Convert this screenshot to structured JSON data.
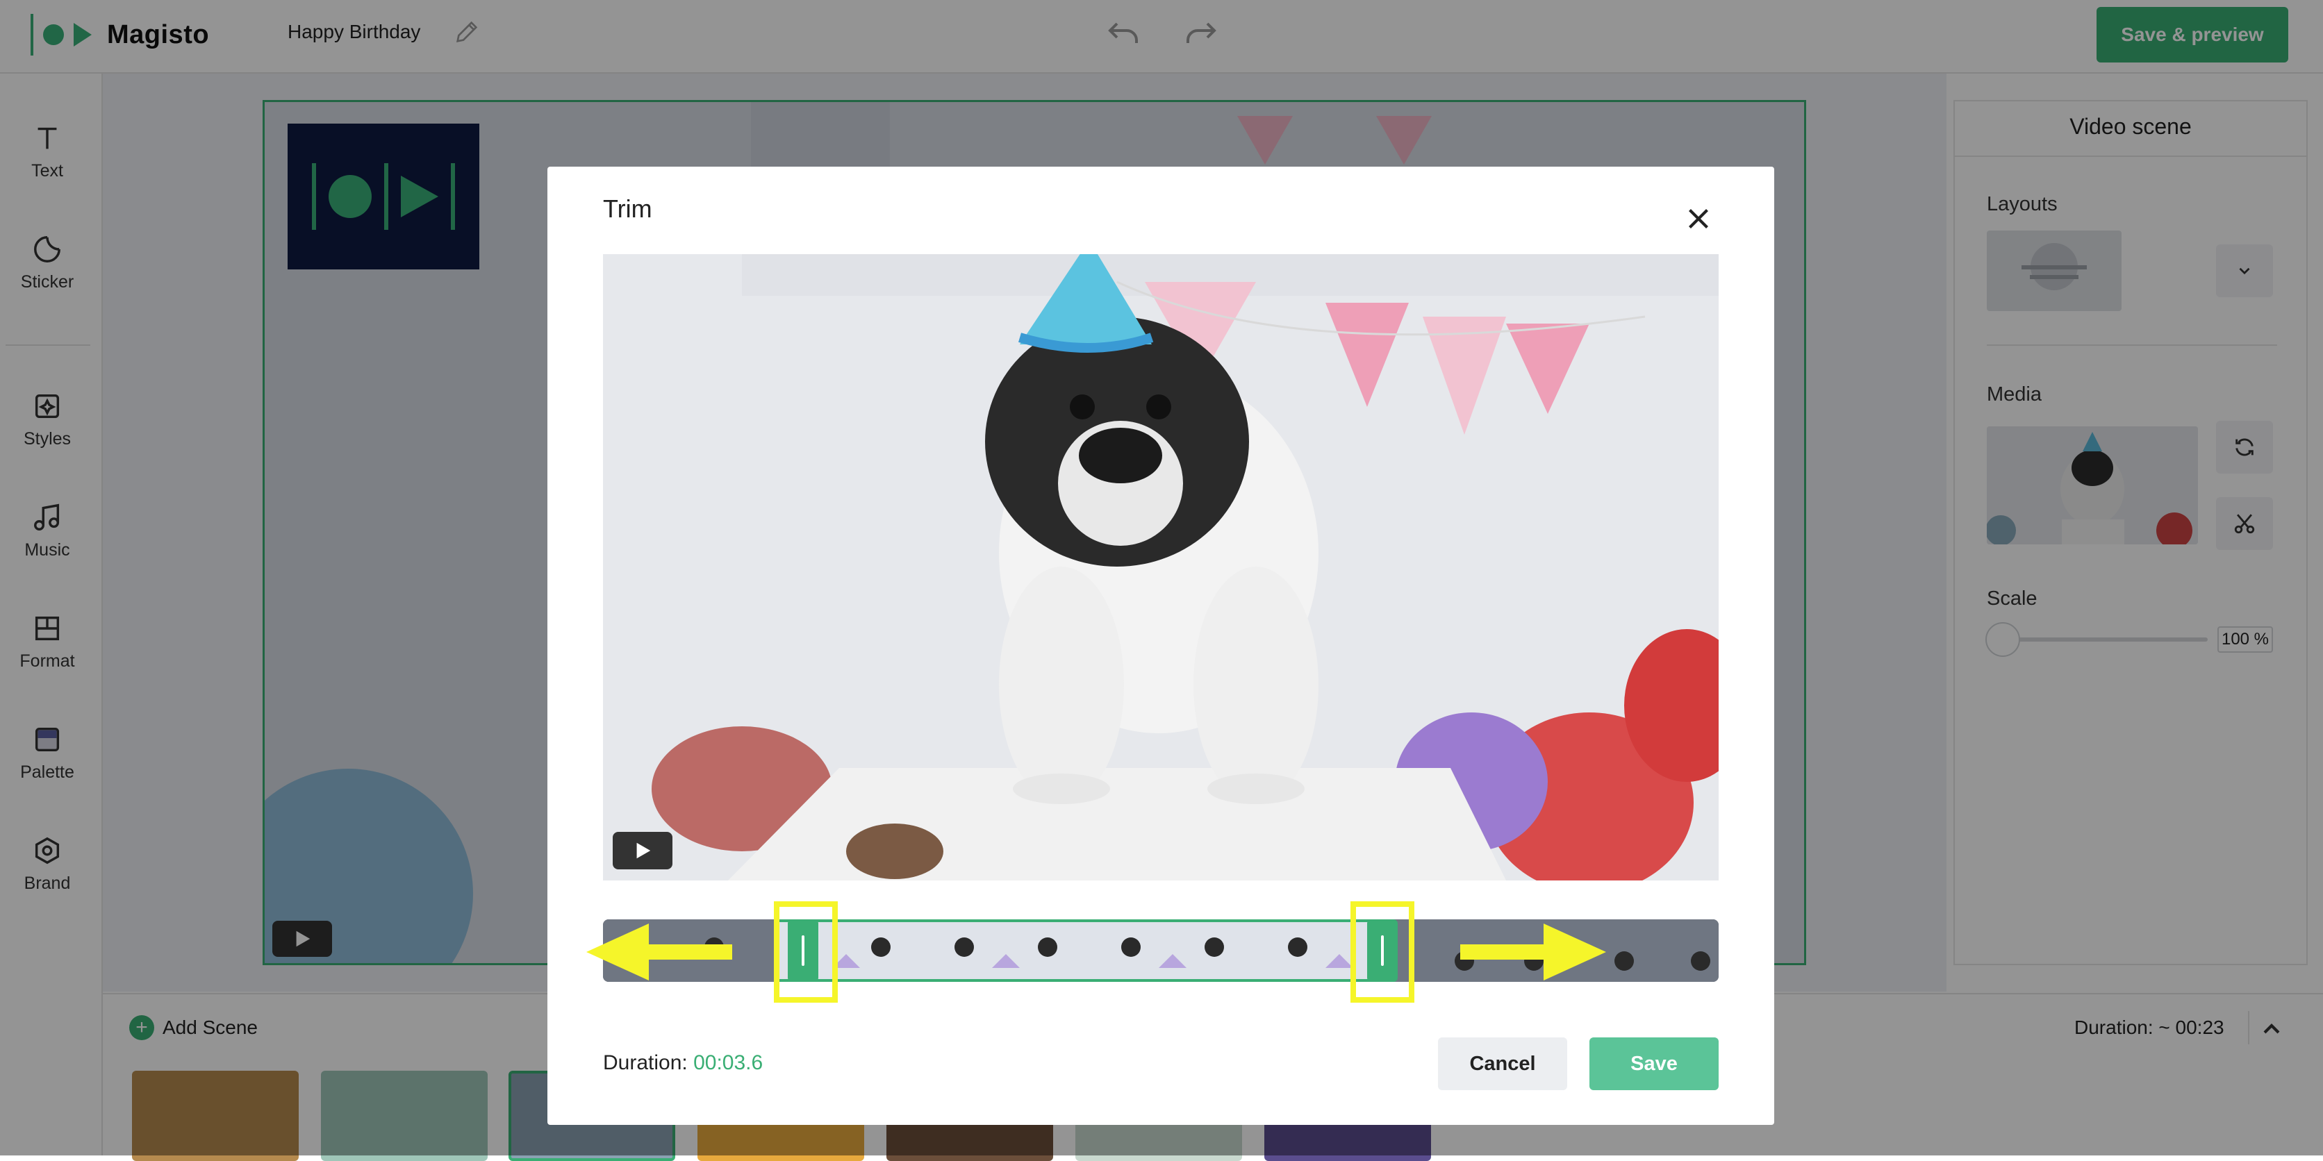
{
  "app": {
    "name": "Magisto",
    "project_title": "Happy Birthday",
    "save_preview_label": "Save & preview"
  },
  "sidebar": {
    "items": [
      {
        "label": "Text",
        "icon": "text-icon"
      },
      {
        "label": "Sticker",
        "icon": "sticker-icon"
      },
      {
        "label": "Styles",
        "icon": "styles-icon"
      },
      {
        "label": "Music",
        "icon": "music-icon"
      },
      {
        "label": "Format",
        "icon": "format-icon"
      },
      {
        "label": "Palette",
        "icon": "palette-icon"
      },
      {
        "label": "Brand",
        "icon": "brand-icon"
      }
    ]
  },
  "right_panel": {
    "title": "Video scene",
    "layouts_label": "Layouts",
    "media_label": "Media",
    "scale_label": "Scale",
    "scale_value": "100 %",
    "scale_fraction": 0
  },
  "bottom": {
    "add_scene_label": "Add Scene",
    "duration_label": "Duration: ~ 00:23",
    "scenes": [
      "scene-1",
      "scene-2",
      "scene-3",
      "scene-4",
      "scene-5",
      "scene-6",
      "scene-7"
    ]
  },
  "trim_modal": {
    "title": "Trim",
    "duration_label": "Duration:",
    "duration_value": "00:03.6",
    "cancel_label": "Cancel",
    "save_label": "Save"
  },
  "colors": {
    "accent": "#3aae74",
    "highlight": "#f5f52a",
    "logo_bg": "#0f1a42"
  }
}
